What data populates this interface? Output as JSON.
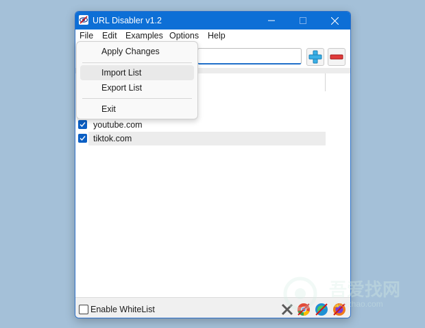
{
  "window": {
    "title": "URL Disabler v1.2"
  },
  "menu": {
    "file": "File",
    "edit": "Edit",
    "examples": "Examples",
    "options": "Options",
    "help": "Help"
  },
  "file_menu": {
    "items": [
      "Apply Changes",
      "Import List",
      "Export List",
      "Exit"
    ],
    "hovered": "Import List"
  },
  "url_input": {
    "value": ""
  },
  "url_list": [
    {
      "url": "youtube.com",
      "checked": true
    },
    {
      "url": "tiktok.com",
      "checked": true
    }
  ],
  "status": {
    "whitelist_label": "Enable WhiteList",
    "whitelist_checked": false
  },
  "status_icons": [
    "close-browsers-icon",
    "chrome-icon",
    "edge-icon",
    "firefox-icon"
  ],
  "watermark": {
    "title": "吾爱找网",
    "subtitle": "wuaizhao.com"
  },
  "colors": {
    "titlebar": "#0d6fd6",
    "desktop": "#a4c0d8",
    "accent": "#0b5fc4"
  }
}
